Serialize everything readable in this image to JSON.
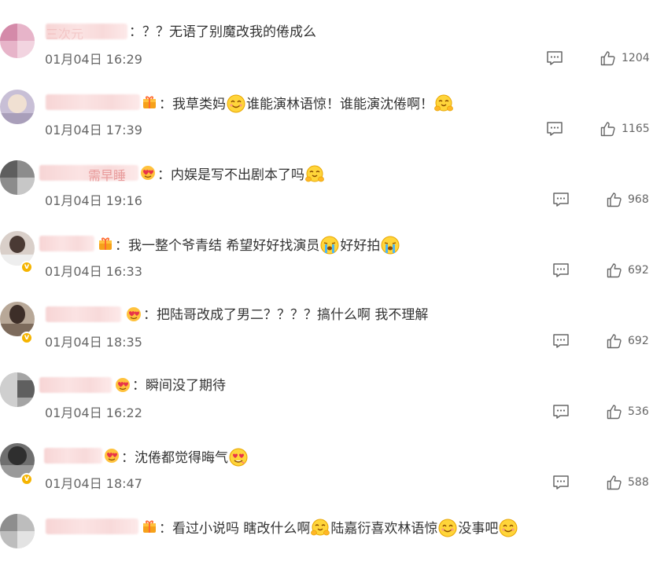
{
  "comments": [
    {
      "name_visible": "三次元",
      "text": "：？？无语了别魔改我的倦成么",
      "time": "01月04日 16:29",
      "likes": "1204",
      "badge": "none",
      "verified": false
    },
    {
      "name_visible": "",
      "text": "：我草类妈",
      "text2": "谁能演林语惊！谁能演沈倦啊！",
      "time": "01月04日 17:39",
      "likes": "1165",
      "badge": "gift",
      "verified": false
    },
    {
      "name_visible": "需早睡",
      "text": "：内娱是写不出剧本了吗",
      "time": "01月04日 19:16",
      "likes": "968",
      "badge": "heart",
      "verified": false
    },
    {
      "name_visible": "",
      "text": "：我一整个爷青结 希望好好找演员",
      "text2": "好好拍",
      "time": "01月04日 16:33",
      "likes": "692",
      "badge": "gift",
      "verified": true
    },
    {
      "name_visible": "",
      "text": "：把陆哥改成了男二？？？？搞什么啊 我不理解",
      "time": "01月04日 18:35",
      "likes": "692",
      "badge": "heart",
      "verified": true
    },
    {
      "name_visible": "",
      "text": "：瞬间没了期待",
      "time": "01月04日 16:22",
      "likes": "536",
      "badge": "heart",
      "verified": false
    },
    {
      "name_visible": "",
      "text": "：沈倦都觉得晦气",
      "time": "01月04日 18:47",
      "likes": "588",
      "badge": "heart",
      "verified": true
    },
    {
      "name_visible": "",
      "text": "：看过小说吗 瞎改什么啊",
      "text2": "陆嘉衍喜欢林语惊",
      "text3": "没事吧",
      "time": "",
      "likes": "",
      "badge": "gift",
      "verified": false
    }
  ],
  "icons": {
    "reply": "comment-icon",
    "like": "thumbs-up-icon",
    "badge_gift": "gift-badge-icon",
    "badge_heart": "heart-badge-icon"
  },
  "colors": {
    "verified": "#f5b400",
    "count": "#666666",
    "badge": "#f6a11a"
  }
}
